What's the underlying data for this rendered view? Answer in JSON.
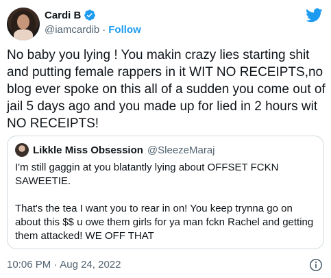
{
  "author": {
    "display_name": "Cardi B",
    "handle": "@iamcardib",
    "follow_label": "Follow",
    "separator": "·"
  },
  "tweet": {
    "text": "No baby you lying ! You makin crazy lies starting shit and putting female rappers in it WIT NO RECEIPTS,no blog ever spoke on this all of a sudden you come out of jail 5 days ago and you made up for lied in 2 hours wit NO RECEIPTS!"
  },
  "quoted": {
    "display_name": "Likkle Miss Obsession",
    "handle": "@SleezeMaraj",
    "text": "I'm still gaggin at you blatantly lying about OFFSET FCKN SAWEETIE.\n\nThat's the tea I want you to rear in on! You keep trynna go on about this $$ u owe them girls for ya man fckn Rachel and getting them attacked! WE OFF THAT"
  },
  "meta": {
    "time": "10:06 PM",
    "separator": "·",
    "date": "Aug 24, 2022"
  },
  "colors": {
    "accent": "#1d9bf0",
    "secondary_text": "#536471",
    "border": "#cfd9de"
  },
  "icons": {
    "brand": "twitter-bird-icon",
    "verified": "verified-badge-icon",
    "info": "info-icon"
  }
}
